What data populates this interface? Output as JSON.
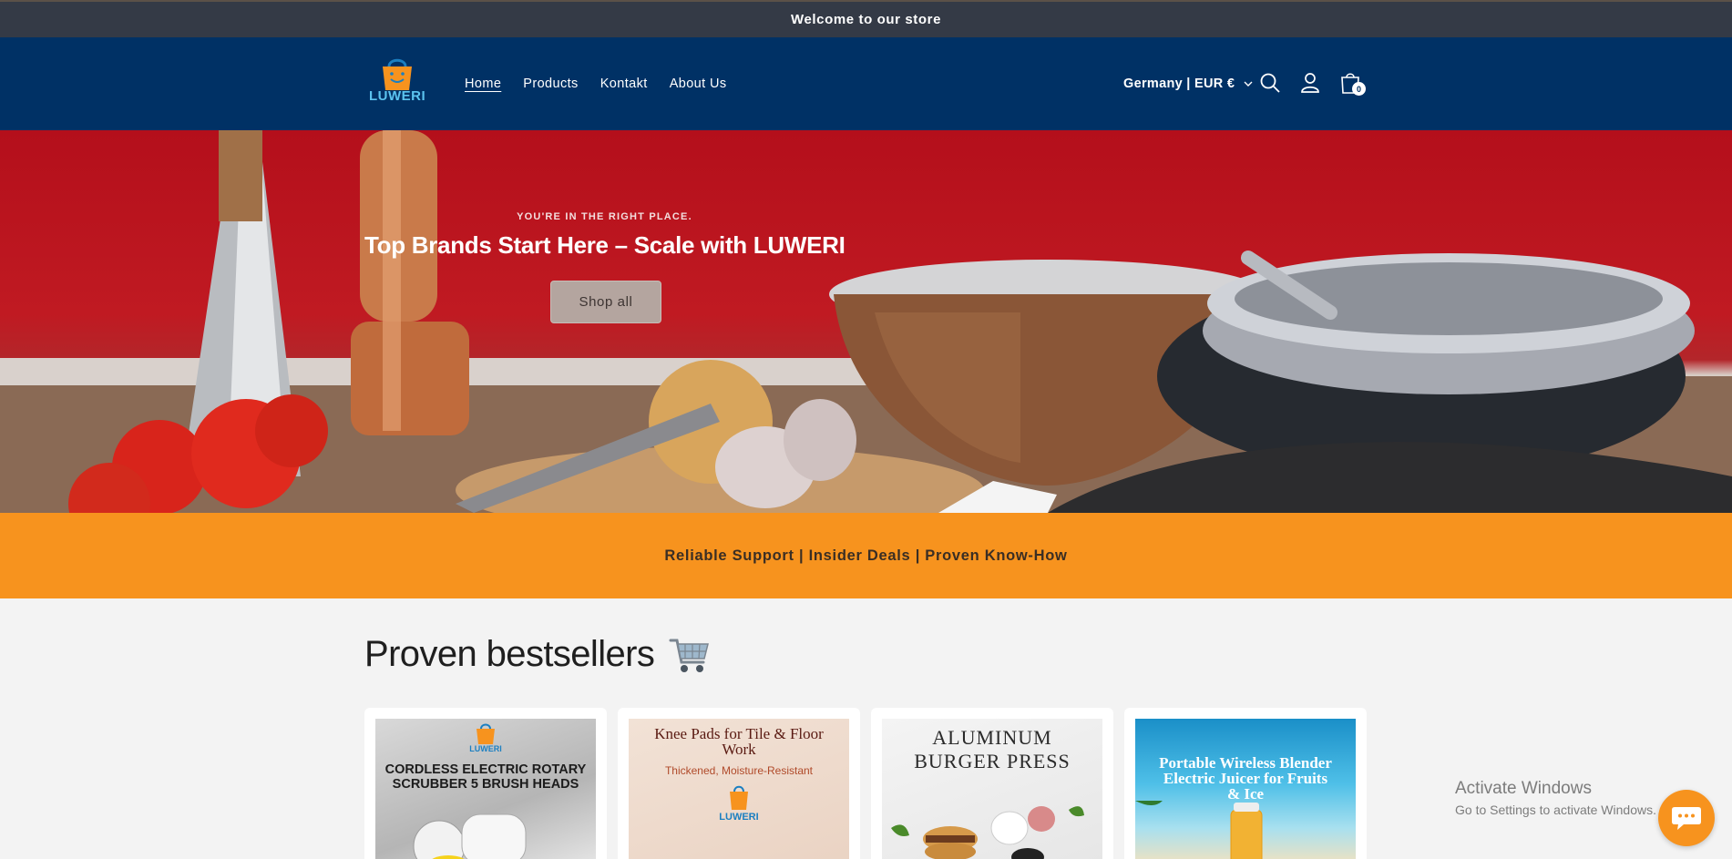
{
  "announcement": {
    "text": "Welcome to our store"
  },
  "header": {
    "logo_text": "LUWERI",
    "nav": [
      {
        "label": "Home",
        "active": true
      },
      {
        "label": "Products",
        "active": false
      },
      {
        "label": "Kontakt",
        "active": false
      },
      {
        "label": "About Us",
        "active": false
      }
    ],
    "locale": "Germany | EUR €",
    "icons": [
      "search-icon",
      "account-icon",
      "cart-icon"
    ],
    "cart_count": "0"
  },
  "hero": {
    "eyebrow": "YOU'RE IN THE RIGHT PLACE.",
    "title": "Top Brands Start Here – Scale with LUWERI",
    "button": "Shop all"
  },
  "usp": {
    "text": "Reliable Support | Insider Deals | Proven Know-How"
  },
  "bestsellers": {
    "title": "Proven bestsellers",
    "emoji": "shopping-cart-icon",
    "products": [
      {
        "image_lines": [
          "CORDLESS ELECTRIC ROTARY",
          "SCRUBBER 5 BRUSH HEADS"
        ],
        "badge": "LUWERI"
      },
      {
        "image_lines": [
          "Knee Pads for Tile & Floor",
          "Work"
        ],
        "subtitle": "Thickened, Moisture-Resistant",
        "badge": "LUWERI"
      },
      {
        "image_lines": [
          "ALUMINUM",
          "BURGER PRESS"
        ]
      },
      {
        "image_lines": [
          "Portable Wireless Blender",
          "Electric Juicer for Fruits",
          "& Ice"
        ]
      }
    ]
  },
  "watermark": {
    "line1": "Activate Windows",
    "line2": "Go to Settings to activate Windows."
  },
  "colors": {
    "header_bg": "#003165",
    "announcement_bg": "#343a46",
    "usp_bg": "#f7931e",
    "page_bg": "#f3f3f3",
    "logo_blue": "#5cc3ef"
  }
}
